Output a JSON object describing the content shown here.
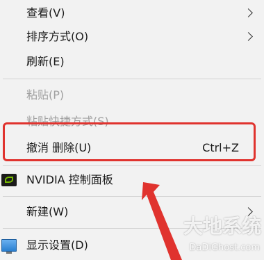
{
  "menu": {
    "items": [
      {
        "label": "查看(V)",
        "submenu": true
      },
      {
        "label": "排序方式(O)",
        "submenu": true
      },
      {
        "label": "刷新(E)"
      },
      {
        "label": "粘贴(P)",
        "disabled": true
      },
      {
        "label": "粘贴快捷方式(S)",
        "disabled": true
      },
      {
        "label": "撤消 删除(U)",
        "shortcut": "Ctrl+Z"
      },
      {
        "label": "NVIDIA 控制面板",
        "icon": "nvidia-icon"
      },
      {
        "label": "新建(W)",
        "submenu": true
      },
      {
        "label": "显示设置(D)",
        "icon": "display-settings-icon"
      }
    ]
  },
  "annotation": {
    "color": "#e0332e"
  },
  "watermark": {
    "text": "大地系统",
    "url": "DaDiGhost.com"
  }
}
